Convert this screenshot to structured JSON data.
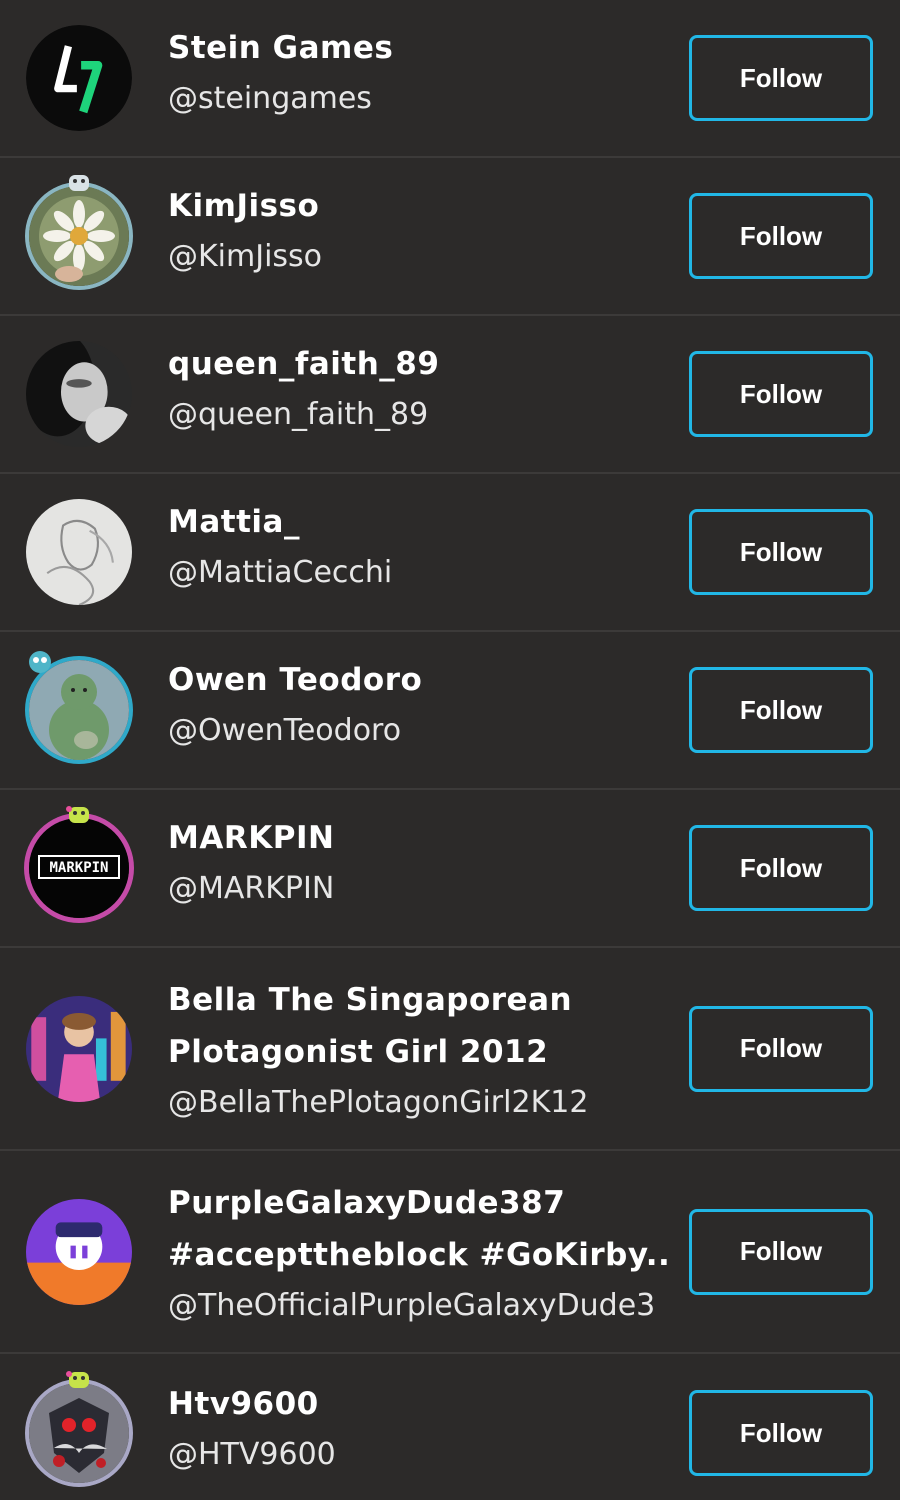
{
  "accent_color": "#21b7e6",
  "users": [
    {
      "name": "Stein Games",
      "handle": "@steingames",
      "follow_label": "Follow",
      "avatar_icon": "stein-games-logo-icon"
    },
    {
      "name": "KimJisso",
      "handle": "@KimJisso",
      "follow_label": "Follow",
      "avatar_icon": "daisy-photo-icon"
    },
    {
      "name": "queen_faith_89",
      "handle": "@queen_faith_89",
      "follow_label": "Follow",
      "avatar_icon": "portrait-photo-icon"
    },
    {
      "name": "Mattia_",
      "handle": "@MattiaCecchi",
      "follow_label": "Follow",
      "avatar_icon": "sketch-portrait-icon"
    },
    {
      "name": "Owen Teodoro",
      "handle": "@OwenTeodoro",
      "follow_label": "Follow",
      "avatar_icon": "green-character-icon"
    },
    {
      "name": "MARKPIN",
      "handle": "@MARKPIN",
      "follow_label": "Follow",
      "avatar_icon": "markpin-logo-icon",
      "avatar_text": "MARKPIN"
    },
    {
      "name_line1": "Bella The Singaporean",
      "name_line2": "Plotagonist Girl 2012",
      "handle": "@BellaThePlotagonGirl2K12",
      "follow_label": "Follow",
      "avatar_icon": "cartoon-girl-icon"
    },
    {
      "name_line1": "PurpleGalaxyDude387",
      "name_line2": "#accepttheblock #GoKirby...",
      "handle": "@TheOfficialPurpleGalaxyDude3",
      "follow_label": "Follow",
      "avatar_icon": "purple-character-icon"
    },
    {
      "name": "Htv9600",
      "handle": "@HTV9600",
      "follow_label": "Follow",
      "avatar_icon": "red-robot-icon"
    }
  ]
}
